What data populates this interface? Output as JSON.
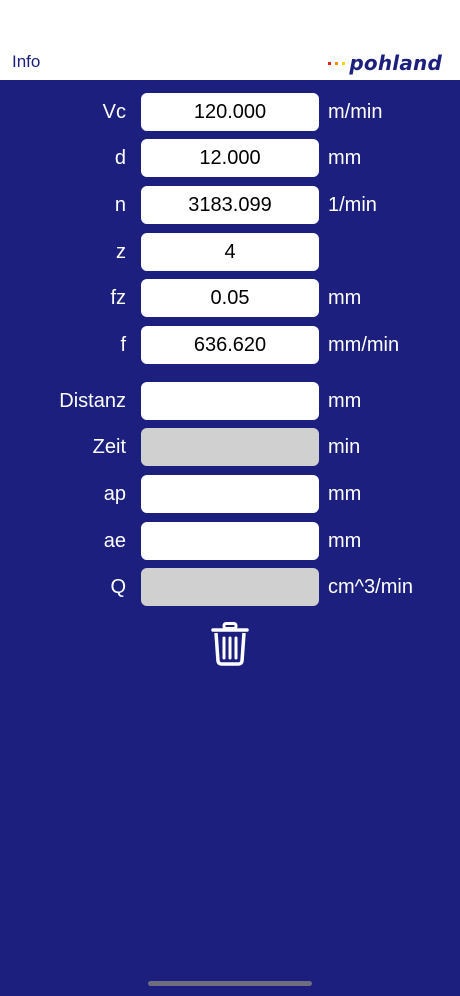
{
  "header": {
    "info_label": "Info",
    "logo_text": "pohland",
    "logo_dot_colors": [
      "#e2231a",
      "#f39200",
      "#ffd500"
    ]
  },
  "colors": {
    "background": "#1c1f7d",
    "field": "#ffffff",
    "field_readonly": "#d0d0d0"
  },
  "fields": [
    {
      "label": "Vc",
      "value": "120.000",
      "unit": "m/min",
      "readonly": false
    },
    {
      "label": "d",
      "value": "12.000",
      "unit": "mm",
      "readonly": false
    },
    {
      "label": "n",
      "value": "3183.099",
      "unit": "1/min",
      "readonly": false
    },
    {
      "label": "z",
      "value": "4",
      "unit": "",
      "readonly": false
    },
    {
      "label": "fz",
      "value": "0.05",
      "unit": "mm",
      "readonly": false
    },
    {
      "label": "f",
      "value": "636.620",
      "unit": "mm/min",
      "readonly": false
    },
    {
      "label": "Distanz",
      "value": "",
      "unit": "mm",
      "readonly": false
    },
    {
      "label": "Zeit",
      "value": "",
      "unit": "min",
      "readonly": true
    },
    {
      "label": "ap",
      "value": "",
      "unit": "mm",
      "readonly": false
    },
    {
      "label": "ae",
      "value": "",
      "unit": "mm",
      "readonly": false
    },
    {
      "label": "Q",
      "value": "",
      "unit": "cm^3/min",
      "readonly": true
    }
  ],
  "actions": {
    "clear_icon": "trash-icon"
  }
}
